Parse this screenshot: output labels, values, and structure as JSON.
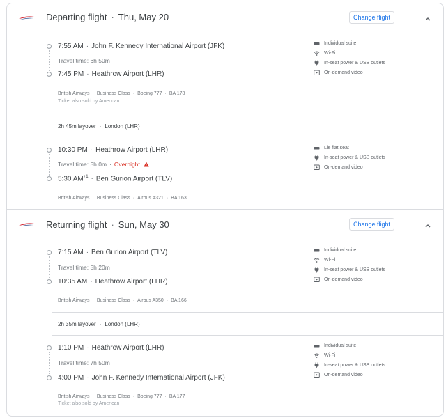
{
  "departing": {
    "title": "Departing flight",
    "date": "Thu, May 20",
    "change_label": "Change flight",
    "segments": [
      {
        "dep_time": "7:55 AM",
        "dep_airport": "John F. Kennedy International Airport (JFK)",
        "travel_time": "Travel time: 6h 50m",
        "arr_time": "7:45 PM",
        "arr_airport": "Heathrow Airport (LHR)",
        "airline": "British Airways",
        "cabin": "Business Class",
        "aircraft": "Boeing 777",
        "flight": "BA 178",
        "sold_by": "Ticket also sold by American",
        "amenities": [
          "Individual suite",
          "Wi-Fi",
          "In-seat power & USB outlets",
          "On-demand video"
        ]
      },
      {
        "dep_time": "10:30 PM",
        "dep_airport": "Heathrow Airport (LHR)",
        "travel_time": "Travel time: 5h 0m",
        "overnight": "Overnight",
        "arr_time": "5:30 AM",
        "arr_sup": "+1",
        "arr_airport": "Ben Gurion Airport (TLV)",
        "airline": "British Airways",
        "cabin": "Business Class",
        "aircraft": "Airbus A321",
        "flight": "BA 163",
        "amenities": [
          "Lie flat seat",
          "In-seat power & USB outlets",
          "On-demand video"
        ]
      }
    ],
    "layover": {
      "duration": "2h 45m layover",
      "city": "London (LHR)"
    }
  },
  "returning": {
    "title": "Returning flight",
    "date": "Sun, May 30",
    "change_label": "Change flight",
    "segments": [
      {
        "dep_time": "7:15 AM",
        "dep_airport": "Ben Gurion Airport (TLV)",
        "travel_time": "Travel time: 5h 20m",
        "arr_time": "10:35 AM",
        "arr_airport": "Heathrow Airport (LHR)",
        "airline": "British Airways",
        "cabin": "Business Class",
        "aircraft": "Airbus A350",
        "flight": "BA 166",
        "amenities": [
          "Individual suite",
          "Wi-Fi",
          "In-seat power & USB outlets",
          "On-demand video"
        ]
      },
      {
        "dep_time": "1:10 PM",
        "dep_airport": "Heathrow Airport (LHR)",
        "travel_time": "Travel time: 7h 50m",
        "arr_time": "4:00 PM",
        "arr_airport": "John F. Kennedy International Airport (JFK)",
        "airline": "British Airways",
        "cabin": "Business Class",
        "aircraft": "Boeing 777",
        "flight": "BA 177",
        "sold_by": "Ticket also sold by American",
        "amenities": [
          "Individual suite",
          "Wi-Fi",
          "In-seat power & USB outlets",
          "On-demand video"
        ]
      }
    ],
    "layover": {
      "duration": "2h 35m layover",
      "city": "London (LHR)"
    }
  },
  "icons": {
    "airline_logo": "british-airways-logo",
    "expand": "chevron-up-icon",
    "suite": "seat-icon",
    "wifi": "wifi-icon",
    "power": "power-plug-icon",
    "video": "video-screen-icon",
    "warning": "warning-icon"
  },
  "colors": {
    "accent": "#1a73e8",
    "warning": "#d93025",
    "logo_red": "#d62e3a",
    "logo_blue": "#2a4b8c"
  }
}
